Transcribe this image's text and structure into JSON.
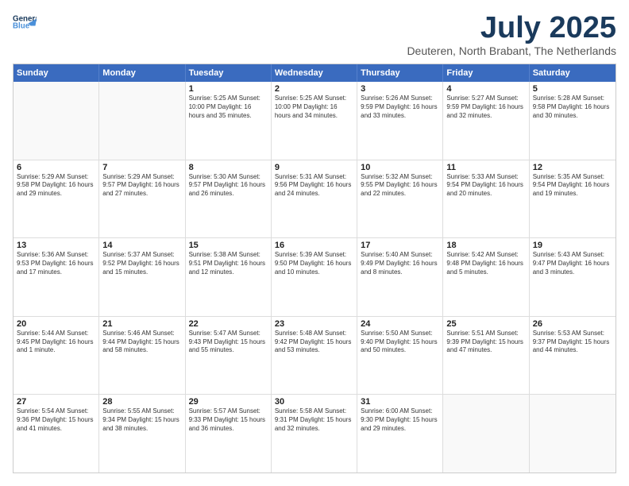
{
  "header": {
    "logo_line1": "General",
    "logo_line2": "Blue",
    "month": "July 2025",
    "location": "Deuteren, North Brabant, The Netherlands"
  },
  "weekdays": [
    "Sunday",
    "Monday",
    "Tuesday",
    "Wednesday",
    "Thursday",
    "Friday",
    "Saturday"
  ],
  "weeks": [
    [
      {
        "day": "",
        "detail": ""
      },
      {
        "day": "",
        "detail": ""
      },
      {
        "day": "1",
        "detail": "Sunrise: 5:25 AM\nSunset: 10:00 PM\nDaylight: 16 hours\nand 35 minutes."
      },
      {
        "day": "2",
        "detail": "Sunrise: 5:25 AM\nSunset: 10:00 PM\nDaylight: 16 hours\nand 34 minutes."
      },
      {
        "day": "3",
        "detail": "Sunrise: 5:26 AM\nSunset: 9:59 PM\nDaylight: 16 hours\nand 33 minutes."
      },
      {
        "day": "4",
        "detail": "Sunrise: 5:27 AM\nSunset: 9:59 PM\nDaylight: 16 hours\nand 32 minutes."
      },
      {
        "day": "5",
        "detail": "Sunrise: 5:28 AM\nSunset: 9:58 PM\nDaylight: 16 hours\nand 30 minutes."
      }
    ],
    [
      {
        "day": "6",
        "detail": "Sunrise: 5:29 AM\nSunset: 9:58 PM\nDaylight: 16 hours\nand 29 minutes."
      },
      {
        "day": "7",
        "detail": "Sunrise: 5:29 AM\nSunset: 9:57 PM\nDaylight: 16 hours\nand 27 minutes."
      },
      {
        "day": "8",
        "detail": "Sunrise: 5:30 AM\nSunset: 9:57 PM\nDaylight: 16 hours\nand 26 minutes."
      },
      {
        "day": "9",
        "detail": "Sunrise: 5:31 AM\nSunset: 9:56 PM\nDaylight: 16 hours\nand 24 minutes."
      },
      {
        "day": "10",
        "detail": "Sunrise: 5:32 AM\nSunset: 9:55 PM\nDaylight: 16 hours\nand 22 minutes."
      },
      {
        "day": "11",
        "detail": "Sunrise: 5:33 AM\nSunset: 9:54 PM\nDaylight: 16 hours\nand 20 minutes."
      },
      {
        "day": "12",
        "detail": "Sunrise: 5:35 AM\nSunset: 9:54 PM\nDaylight: 16 hours\nand 19 minutes."
      }
    ],
    [
      {
        "day": "13",
        "detail": "Sunrise: 5:36 AM\nSunset: 9:53 PM\nDaylight: 16 hours\nand 17 minutes."
      },
      {
        "day": "14",
        "detail": "Sunrise: 5:37 AM\nSunset: 9:52 PM\nDaylight: 16 hours\nand 15 minutes."
      },
      {
        "day": "15",
        "detail": "Sunrise: 5:38 AM\nSunset: 9:51 PM\nDaylight: 16 hours\nand 12 minutes."
      },
      {
        "day": "16",
        "detail": "Sunrise: 5:39 AM\nSunset: 9:50 PM\nDaylight: 16 hours\nand 10 minutes."
      },
      {
        "day": "17",
        "detail": "Sunrise: 5:40 AM\nSunset: 9:49 PM\nDaylight: 16 hours\nand 8 minutes."
      },
      {
        "day": "18",
        "detail": "Sunrise: 5:42 AM\nSunset: 9:48 PM\nDaylight: 16 hours\nand 5 minutes."
      },
      {
        "day": "19",
        "detail": "Sunrise: 5:43 AM\nSunset: 9:47 PM\nDaylight: 16 hours\nand 3 minutes."
      }
    ],
    [
      {
        "day": "20",
        "detail": "Sunrise: 5:44 AM\nSunset: 9:45 PM\nDaylight: 16 hours\nand 1 minute."
      },
      {
        "day": "21",
        "detail": "Sunrise: 5:46 AM\nSunset: 9:44 PM\nDaylight: 15 hours\nand 58 minutes."
      },
      {
        "day": "22",
        "detail": "Sunrise: 5:47 AM\nSunset: 9:43 PM\nDaylight: 15 hours\nand 55 minutes."
      },
      {
        "day": "23",
        "detail": "Sunrise: 5:48 AM\nSunset: 9:42 PM\nDaylight: 15 hours\nand 53 minutes."
      },
      {
        "day": "24",
        "detail": "Sunrise: 5:50 AM\nSunset: 9:40 PM\nDaylight: 15 hours\nand 50 minutes."
      },
      {
        "day": "25",
        "detail": "Sunrise: 5:51 AM\nSunset: 9:39 PM\nDaylight: 15 hours\nand 47 minutes."
      },
      {
        "day": "26",
        "detail": "Sunrise: 5:53 AM\nSunset: 9:37 PM\nDaylight: 15 hours\nand 44 minutes."
      }
    ],
    [
      {
        "day": "27",
        "detail": "Sunrise: 5:54 AM\nSunset: 9:36 PM\nDaylight: 15 hours\nand 41 minutes."
      },
      {
        "day": "28",
        "detail": "Sunrise: 5:55 AM\nSunset: 9:34 PM\nDaylight: 15 hours\nand 38 minutes."
      },
      {
        "day": "29",
        "detail": "Sunrise: 5:57 AM\nSunset: 9:33 PM\nDaylight: 15 hours\nand 36 minutes."
      },
      {
        "day": "30",
        "detail": "Sunrise: 5:58 AM\nSunset: 9:31 PM\nDaylight: 15 hours\nand 32 minutes."
      },
      {
        "day": "31",
        "detail": "Sunrise: 6:00 AM\nSunset: 9:30 PM\nDaylight: 15 hours\nand 29 minutes."
      },
      {
        "day": "",
        "detail": ""
      },
      {
        "day": "",
        "detail": ""
      }
    ]
  ]
}
